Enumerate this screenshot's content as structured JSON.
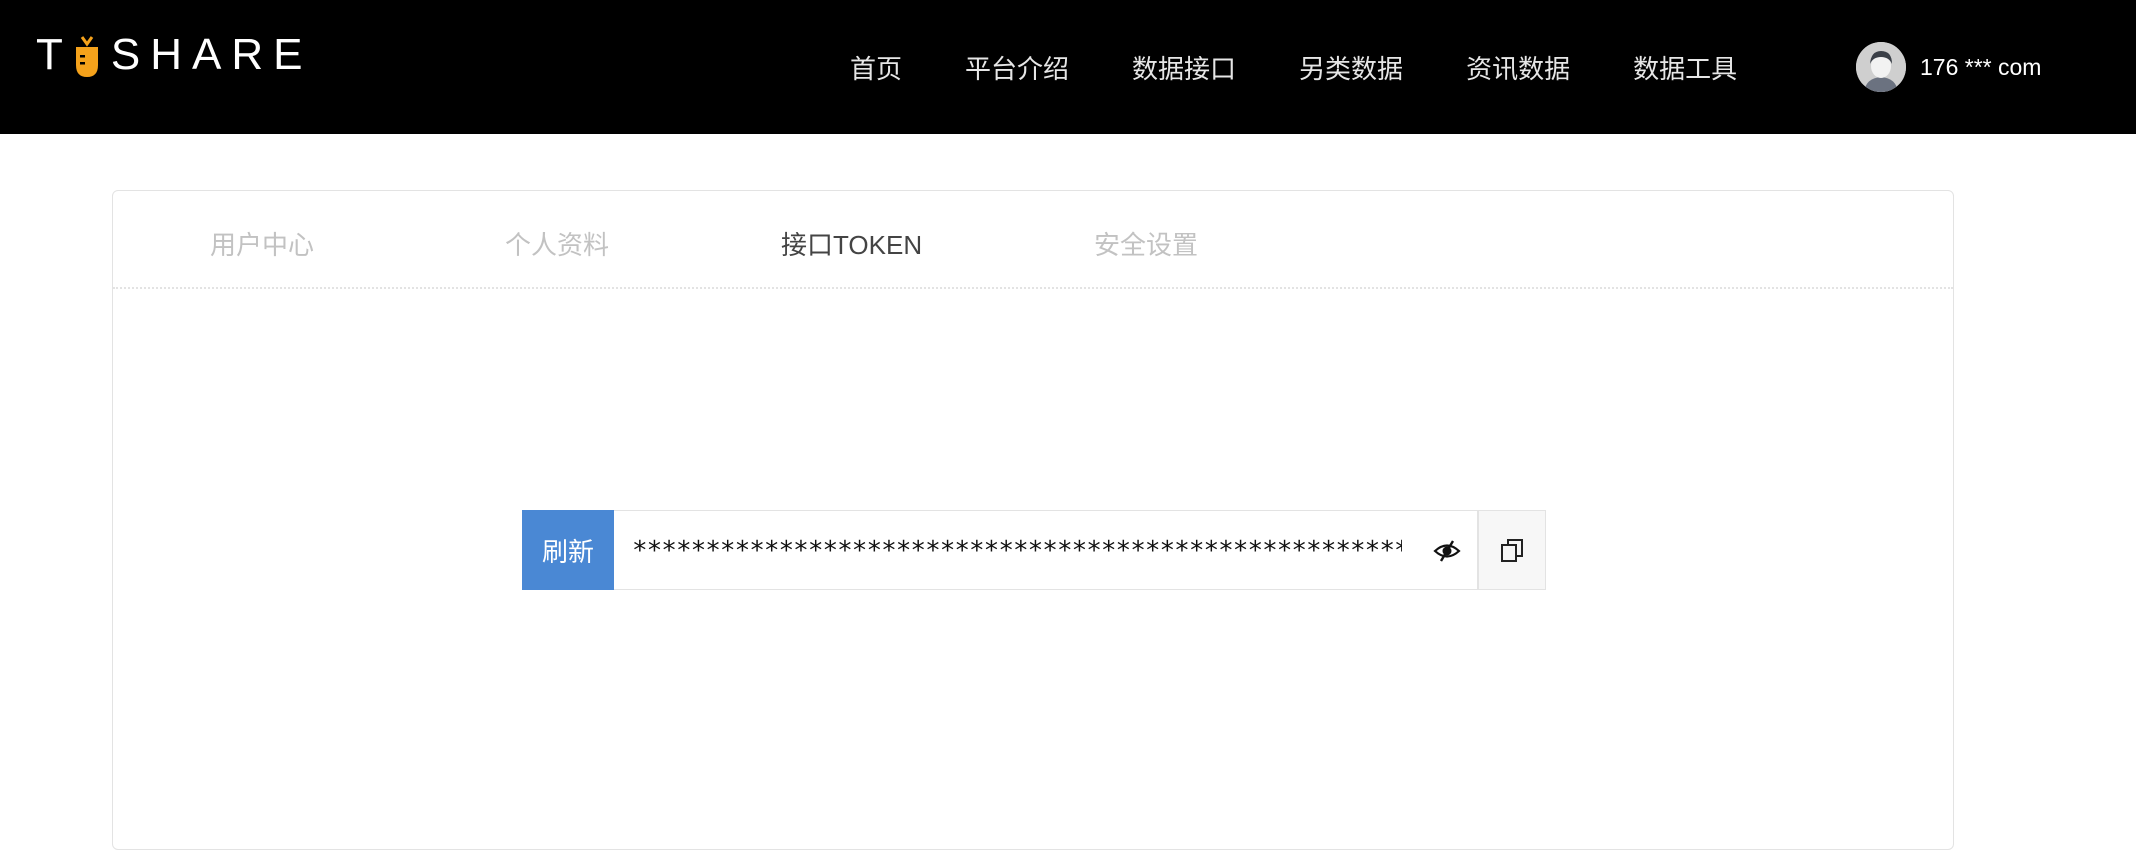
{
  "brand": {
    "logo_left": "T",
    "logo_right": "SHARE",
    "accent_color": "#f5a21b"
  },
  "nav": {
    "items": [
      {
        "label": "首页"
      },
      {
        "label": "平台介绍"
      },
      {
        "label": "数据接口"
      },
      {
        "label": "另类数据"
      },
      {
        "label": "资讯数据"
      },
      {
        "label": "数据工具"
      }
    ]
  },
  "user": {
    "display_name": "176 *** com",
    "avatar_icon": "user-avatar-icon"
  },
  "tabs": {
    "items": [
      {
        "label": "用户中心"
      },
      {
        "label": "个人资料"
      },
      {
        "label": "接口TOKEN"
      },
      {
        "label": "安全设置"
      }
    ],
    "active_index": 2
  },
  "token": {
    "refresh_label": "刷新",
    "masked_value": "*****************************************************************",
    "visibility_icon": "eye-slash-icon",
    "copy_icon": "copy-icon",
    "button_color": "#4a88d4"
  }
}
